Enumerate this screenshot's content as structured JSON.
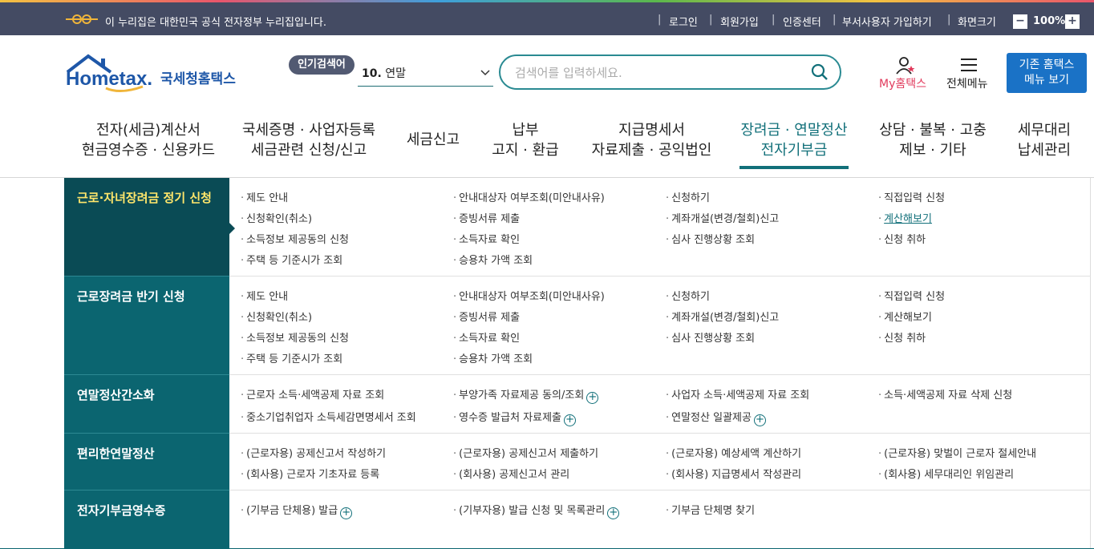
{
  "gov_banner": {
    "text": "이 누리집은 대한민국 공식 전자정부 누리집입니다.",
    "links": [
      "로그인",
      "회원가입",
      "인증센터",
      "부서사용자 가입하기",
      "화면크기"
    ],
    "zoom_minus": "−",
    "zoom_value": "100%",
    "zoom_plus": "+"
  },
  "header": {
    "logo_text": "국세청홈택스",
    "popular_keyword_tag": "인기검색어",
    "popular_keyword_rank": "10.",
    "popular_keyword_value": "연말",
    "search_placeholder": "검색어를 입력하세요.",
    "my_hometax_label": "My홈택스",
    "all_menu_label": "전체메뉴",
    "old_menu_line1": "기존 홈택스",
    "old_menu_line2": "메뉴 보기"
  },
  "gnb": [
    {
      "line1": "전자(세금)계산서",
      "line2": "현금영수증 · 신용카드"
    },
    {
      "line1": "국세증명 · 사업자등록",
      "line2": "세금관련 신청/신고"
    },
    {
      "line1": "세금신고",
      "line2": ""
    },
    {
      "line1": "납부",
      "line2": "고지 · 환급"
    },
    {
      "line1": "지급명세서",
      "line2": "자료제출 · 공익법인"
    },
    {
      "line1": "장려금 · 연말정산",
      "line2": "전자기부금"
    },
    {
      "line1": "상담 · 불복 · 고충",
      "line2": "제보 · 기타"
    },
    {
      "line1": "세무대리",
      "line2": "납세관리"
    }
  ],
  "categories": [
    {
      "label": "근로·자녀장려금 정기 신청"
    },
    {
      "label": "근로장려금 반기 신청"
    },
    {
      "label": "연말정산간소화"
    },
    {
      "label": "편리한연말정산"
    },
    {
      "label": "전자기부금영수증"
    }
  ],
  "items": {
    "c0": [
      "제도 안내",
      "안내대상자 여부조회(미안내사유)",
      "신청하기",
      "직접입력 신청",
      "신청확인(취소)",
      "증빙서류 제출",
      "계좌개설(변경/철회)신고",
      "계산해보기",
      "소득정보 제공동의 신청",
      "소득자료 확인",
      "심사 진행상황 조회",
      "신청 취하",
      "주택 등 기준시가 조회",
      "승용차 가액 조회"
    ],
    "c1": [
      "제도 안내",
      "안내대상자 여부조회(미안내사유)",
      "신청하기",
      "직접입력 신청",
      "신청확인(취소)",
      "증빙서류 제출",
      "계좌개설(변경/철회)신고",
      "계산해보기",
      "소득정보 제공동의 신청",
      "소득자료 확인",
      "심사 진행상황 조회",
      "신청 취하",
      "주택 등 기준시가 조회",
      "승용차 가액 조회"
    ],
    "c2": [
      "근로자 소득·세액공제 자료 조회",
      "부양가족 자료제공 동의/조회",
      "사업자 소득·세액공제 자료 조회",
      "소득·세액공제 자료 삭제 신청",
      "중소기업취업자 소득세감면명세서 조회",
      "영수증 발급처 자료제출",
      "연말정산 일괄제공"
    ],
    "c3": [
      "(근로자용) 공제신고서 작성하기",
      "(근로자용) 공제신고서 제출하기",
      "(근로자용) 예상세액 계산하기",
      "(근로자용) 맞벌이 근로자 절세안내",
      "(회사용) 근로자 기초자료 등록",
      "(회사용) 공제신고서 관리",
      "(회사용) 지급명세서 작성관리",
      "(회사용) 세무대리인 위임관리"
    ],
    "c4": [
      "(기부금 단체용) 발급",
      "(기부자용) 발급 신청 및 목록관리",
      "기부금 단체명 찾기"
    ]
  },
  "bullet": "·",
  "plus_symbol": "+",
  "colors": {
    "gov_bar": "#444b63",
    "brand_teal": "#0b6570",
    "active_teal": "#0a4b55",
    "accent_yellow": "#ffe66b",
    "old_menu_blue": "#1a72c6",
    "my_pink": "#e13a5c"
  }
}
